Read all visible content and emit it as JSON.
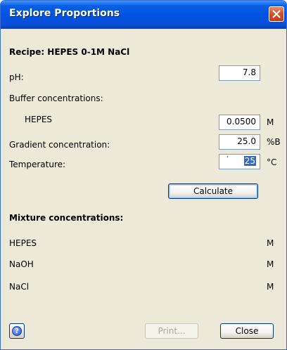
{
  "window": {
    "title": "Explore Proportions",
    "close_icon": "close-icon"
  },
  "recipe": {
    "label": "Recipe: HEPES 0-1M NaCl"
  },
  "inputs": {
    "ph": {
      "label": "pH:",
      "value": "7.8"
    },
    "buffer_section": {
      "label": "Buffer concentrations:"
    },
    "hepes": {
      "label": "HEPES",
      "value": "0.0500",
      "unit": "M"
    },
    "gradient": {
      "label": "Gradient concentration:",
      "value": "25.0",
      "unit": "%B"
    },
    "temperature": {
      "label": "Temperature:",
      "value": "25",
      "unit": "°C"
    }
  },
  "buttons": {
    "calculate": "Calculate",
    "print": "Print...",
    "close": "Close",
    "help_icon": "?"
  },
  "mixture": {
    "heading": "Mixture concentrations:",
    "rows": [
      {
        "name": "HEPES",
        "unit": "M"
      },
      {
        "name": "NaOH",
        "unit": "M"
      },
      {
        "name": "NaCl",
        "unit": "M"
      }
    ]
  }
}
